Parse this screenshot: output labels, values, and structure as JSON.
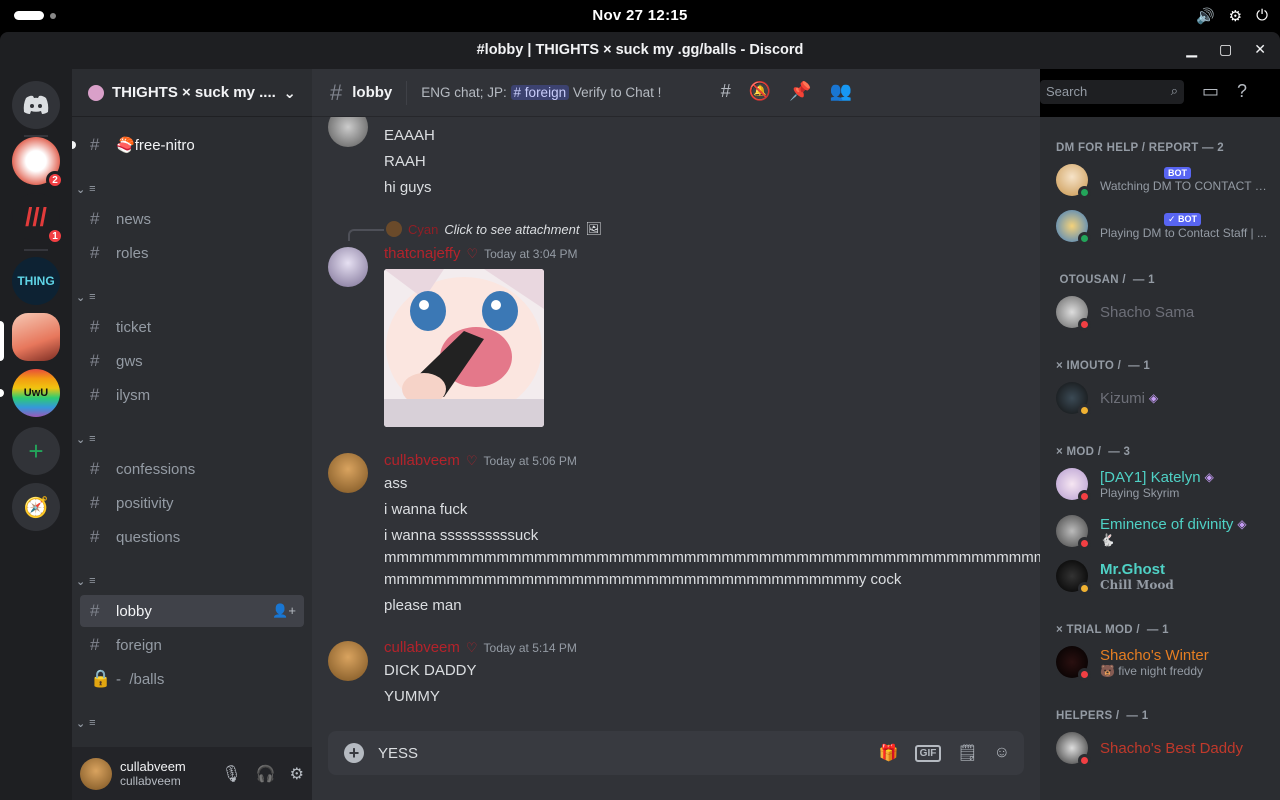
{
  "system": {
    "clock": "Nov 27  12:15"
  },
  "window": {
    "title": "#⁣lobby | THIGHTS × suck my .gg/balls - Discord"
  },
  "servers": [
    {
      "name": "discord-home",
      "badge": ""
    },
    {
      "name": "server-2",
      "badge": "2"
    },
    {
      "name": "server-3",
      "badge": "1"
    },
    {
      "name": "server-thing",
      "label": "THING",
      "badge": ""
    },
    {
      "name": "server-anime",
      "badge": ""
    },
    {
      "name": "server-uwu",
      "label": "UwU",
      "badge": ""
    }
  ],
  "guild": {
    "name": "THIGHTS × suck my ...."
  },
  "channels": {
    "free_nitro": "⁣free-nitro",
    "cat1": "≡ ⁣   ⁣⁣",
    "news": "⁣news",
    "roles": "⁣roles",
    "cat2": "≡ ⁣   ⁣⁣",
    "ticket": "⁣ticket",
    "gws": "⁣gws",
    "ilysm": "⁣ilysm",
    "cat3": "≡ ⁣   ⁣",
    "confessions": "⁣confessions",
    "positivity": "⁣positivity",
    "questions": "⁣questions",
    "cat4": "≡ ⁣   ⁣⁣",
    "lobby": "⁣lobby",
    "foreign": "⁣foreign",
    "balls": "- ⁣ /balls",
    "cat5": "≡ ⁣   ⁣⁣"
  },
  "user": {
    "name": "cullabveem",
    "tag": "cullabveem"
  },
  "header": {
    "channel": "⁣lobby",
    "topic_prefix": "ENG chat; JP:",
    "topic_mention": "# ⁣foreign",
    "topic_suffix": "Verify to Chat !",
    "search_placeholder": "Search"
  },
  "messages": {
    "m1_l1": "EAAAH",
    "m1_l2": "RAAH",
    "m1_l3": "hi guys",
    "reply_name": "Cyan",
    "reply_text": "Click to see attachment",
    "m2_author": "thatcnajeffy",
    "m2_time": "Today at 3:04 PM",
    "m3_author": "cullabveem",
    "m3_time": "Today at 5:06 PM",
    "m3_l1": "ass",
    "m3_l2": "i wanna fuck",
    "m3_l3": "i wanna ssssssssssuck",
    "m3_l4": "mmmmmmmmmmmmmmmmmmmmmmmmmmmmmmmmmmmmmmmmmmmmmmmmmmmmmmmmm",
    "m3_l5": "mmmmmmmmmmmmmmmmmmmmmmmmmmmmmmmmmmmmmmy cock",
    "m3_l6": "please man",
    "m4_author": "cullabveem",
    "m4_time": "Today at 5:14 PM",
    "m4_l1": "DICK DADDY",
    "m4_l2": "YUMMY"
  },
  "composer": {
    "text": "YESS"
  },
  "members": {
    "role1": "⁣DM FOR HELP / REPORT — 2",
    "bot1_status": "Watching DM TO CONTACT S...",
    "bot1_badge": "BOT",
    "bot2_status": "Playing DM to Contact Staff | ...",
    "bot2_badge": "✓ BOT",
    "role2": "⁣ OTOUSAN / ⁣⁣⁣⁣ — 1",
    "m_shacho": "Shacho Sama",
    "role3": "× IMOUTO / ⁣ — 1",
    "m_kizumi": "Kizumi",
    "role4": "× MOD / ⁣⁣⁣⁣⁣ — 3",
    "m_katelyn": "[DAY1] Katelyn",
    "m_katelyn_sub": "Playing Skyrim",
    "m_eminence": "Eminence of divinity",
    "m_ghost": "Mr.Ghost",
    "m_ghost_sub": "Chill Mood",
    "role5": "× TRIAL MOD / ⁣⁣⁣⁣⁣ — 1",
    "m_winter": "Shacho's Winter",
    "m_winter_sub": "five night freddy",
    "role6": "⁣HELPERS / ⁣⁣⁣⁣ — 1",
    "m_helper": "Shacho's Best Daddy"
  },
  "colors": {
    "accent": "#5865f2",
    "mod_name": "#4fd1c5",
    "trial_mod": "#e67e22",
    "helper": "#c0392b",
    "author": "#b3232b"
  }
}
